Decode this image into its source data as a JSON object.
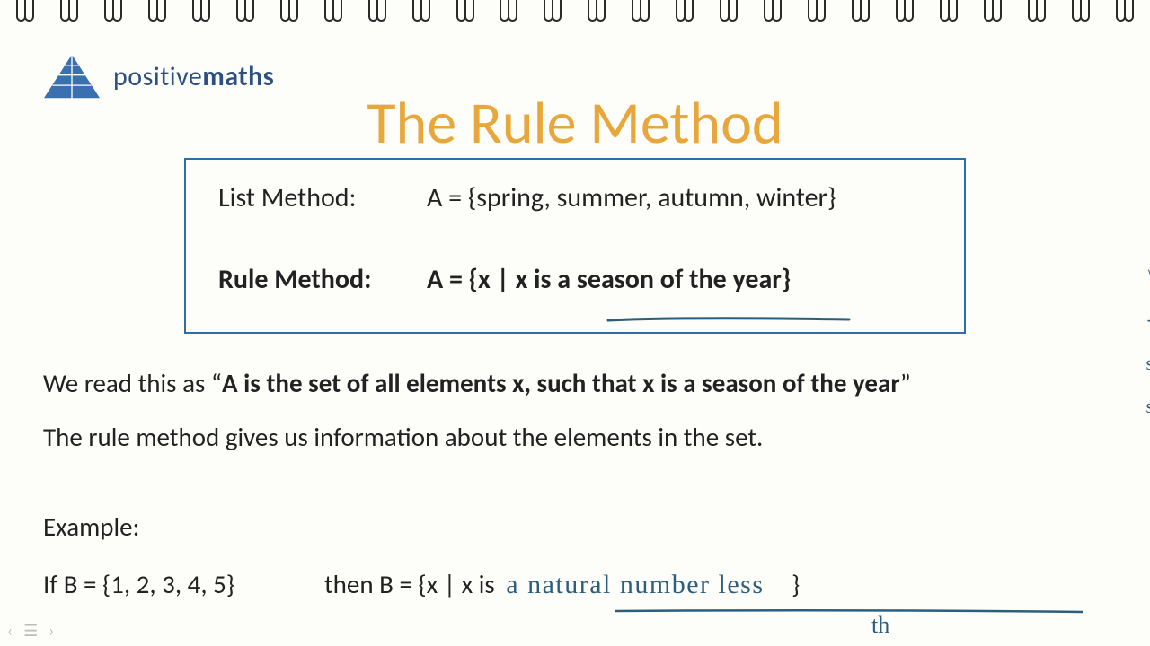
{
  "brand": {
    "name_light": "positive",
    "name_bold": "maths"
  },
  "title": "The Rule Method",
  "box": {
    "list_label": "List Method:",
    "list_value": "A = {spring, summer, autumn, winter}",
    "rule_label": "Rule Method:",
    "rule_value": "A = {x | x is a season of the year}"
  },
  "reading_prefix": "We read this as “",
  "reading_bold": "A is the set of all elements x, such that x is a season of the year",
  "reading_suffix": "”",
  "line2": "The rule method gives us information about the elements in the set.",
  "example_label": "Example:",
  "example_if": "If B = {1, 2, 3, 4, 5}",
  "example_then_prefix": "then B = {x | x is ",
  "handwritten": "a  natural  number  less",
  "handwritten2": "th",
  "closing": " }",
  "bottom_controls": {
    "prev": "‹",
    "menu": "☰",
    "next": "›"
  }
}
